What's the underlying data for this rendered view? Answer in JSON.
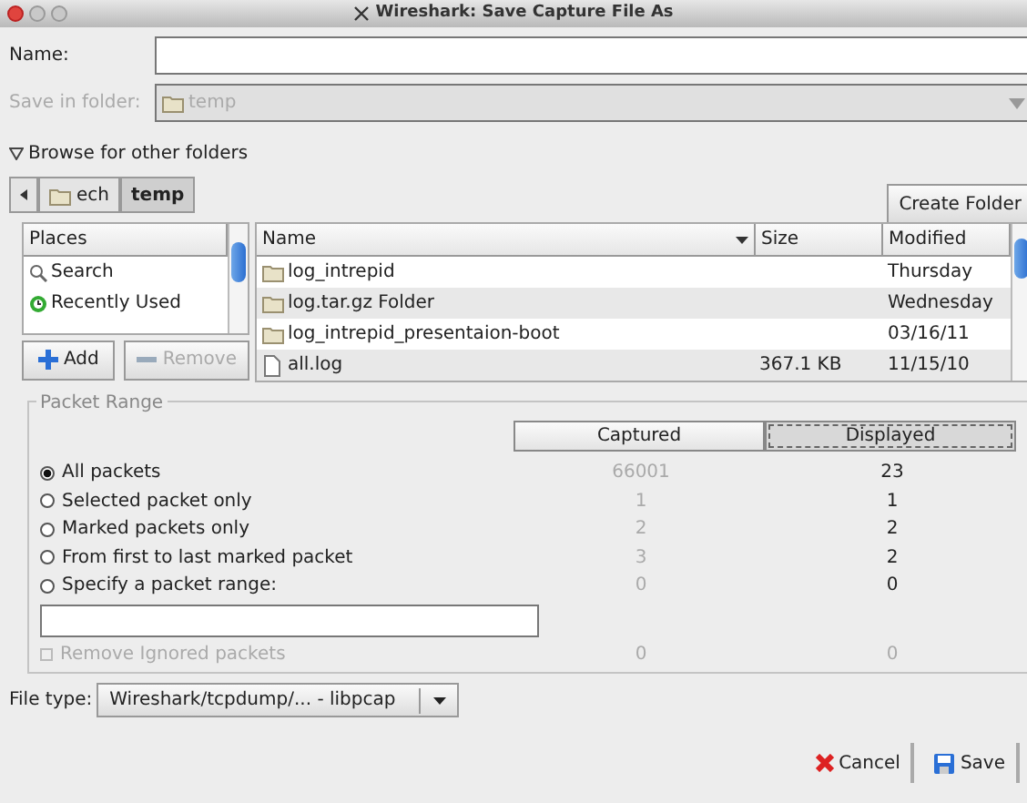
{
  "window": {
    "title": "Wireshark: Save Capture File As"
  },
  "name_field": {
    "label": "Name:"
  },
  "save_in_folder": {
    "label": "Save in folder:",
    "value": "temp",
    "disabled": true
  },
  "browse": {
    "label": "Browse for other folders",
    "expanded": true
  },
  "path_bar": [
    {
      "label": "ech",
      "selected": false,
      "kind": "folder"
    },
    {
      "label": "temp",
      "selected": true,
      "kind": "plain"
    }
  ],
  "create_folder_button": "Create Folder",
  "places": {
    "header": "Places",
    "items": [
      {
        "label": "Search",
        "kind": "search"
      },
      {
        "label": "Recently Used",
        "kind": "recent"
      }
    ]
  },
  "places_buttons": [
    {
      "label": "Add",
      "disabled": false,
      "kind": "add"
    },
    {
      "label": "Remove",
      "disabled": true,
      "kind": "remove"
    }
  ],
  "files": {
    "columns": [
      "Name",
      "Size",
      "Modified"
    ],
    "rows": [
      {
        "name": "log_intrepid",
        "size": "",
        "modified": "Thursday",
        "kind": "folder"
      },
      {
        "name": "log.tar.gz Folder",
        "size": "",
        "modified": "Wednesday",
        "kind": "folder"
      },
      {
        "name": "log_intrepid_presentaion-boot",
        "size": "",
        "modified": "03/16/11",
        "kind": "folder"
      },
      {
        "name": "all.log",
        "size": "367.1 KB",
        "modified": "11/15/10",
        "kind": "file"
      }
    ]
  },
  "packet_range": {
    "title": "Packet Range",
    "columns": [
      {
        "label": "Captured",
        "selected": false
      },
      {
        "label": "Displayed",
        "selected": true
      }
    ],
    "options": [
      {
        "label": "All packets",
        "selected": true,
        "captured": "66001",
        "displayed": "23"
      },
      {
        "label": "Selected packet only",
        "selected": false,
        "captured": "1",
        "displayed": "1"
      },
      {
        "label": "Marked packets only",
        "selected": false,
        "captured": "2",
        "displayed": "2"
      },
      {
        "label": "From first to last marked packet",
        "selected": false,
        "captured": "3",
        "displayed": "2"
      },
      {
        "label": "Specify a packet range:",
        "selected": false,
        "captured": "0",
        "displayed": "0"
      }
    ],
    "remove_ignored": {
      "label": "Remove Ignored packets",
      "checked": false,
      "disabled": true,
      "captured": "0",
      "displayed": "0"
    }
  },
  "file_type": {
    "label": "File type:",
    "value": "Wireshark/tcpdump/... - libpcap"
  },
  "buttons": [
    {
      "label": "Cancel",
      "kind": "cancel"
    },
    {
      "label": "Save",
      "kind": "save"
    }
  ]
}
